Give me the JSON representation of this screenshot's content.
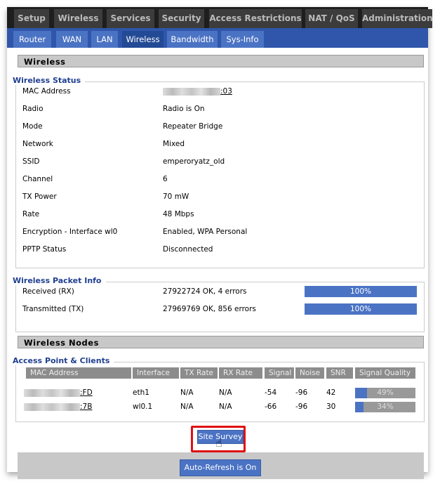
{
  "top_tabs": [
    "Setup",
    "Wireless",
    "Services",
    "Security",
    "Access Restrictions",
    "NAT / QoS",
    "Administration"
  ],
  "sub_tabs": [
    "Router",
    "WAN",
    "LAN",
    "Wireless",
    "Bandwidth",
    "Sys-Info"
  ],
  "active_sub_tab": "Wireless",
  "section_title": "Wireless",
  "wireless_status": {
    "legend": "Wireless Status",
    "rows": [
      {
        "label": "MAC Address",
        "value": ":03"
      },
      {
        "label": "Radio",
        "value": "Radio is On"
      },
      {
        "label": "Mode",
        "value": "Repeater Bridge"
      },
      {
        "label": "Network",
        "value": "Mixed"
      },
      {
        "label": "SSID",
        "value": "emperoryatz_old"
      },
      {
        "label": "Channel",
        "value": "6"
      },
      {
        "label": "TX Power",
        "value": "70 mW"
      },
      {
        "label": "Rate",
        "value": "48 Mbps"
      },
      {
        "label": "Encryption - Interface wl0",
        "value": "Enabled, WPA Personal"
      },
      {
        "label": "PPTP Status",
        "value": "Disconnected"
      }
    ]
  },
  "packet_info": {
    "legend": "Wireless Packet Info",
    "rows": [
      {
        "label": "Received (RX)",
        "value": "27922724 OK, 4 errors",
        "percent": 100,
        "percent_label": "100%"
      },
      {
        "label": "Transmitted (TX)",
        "value": "27969769 OK, 856 errors",
        "percent": 100,
        "percent_label": "100%"
      }
    ]
  },
  "nodes_title": "Wireless Nodes",
  "clients": {
    "legend": "Access Point & Clients",
    "headers": [
      "MAC Address",
      "Interface",
      "TX Rate",
      "RX Rate",
      "Signal",
      "Noise",
      "SNR",
      "Signal Quality"
    ],
    "rows": [
      {
        "mac": ":FD",
        "interface": "eth1",
        "tx": "N/A",
        "rx": "N/A",
        "signal": "-54",
        "noise": "-96",
        "snr": "42",
        "quality": 49,
        "quality_label": "49%"
      },
      {
        "mac": ":7B",
        "interface": "wl0.1",
        "tx": "N/A",
        "rx": "N/A",
        "signal": "-66",
        "noise": "-96",
        "snr": "30",
        "quality": 34,
        "quality_label": "34%"
      }
    ]
  },
  "buttons": {
    "site_survey": "Site Survey",
    "auto_refresh": "Auto-Refresh is On"
  },
  "colors": {
    "accent": "#4b73c4",
    "nav": "#2f56aa",
    "highlight": "#e01010"
  }
}
